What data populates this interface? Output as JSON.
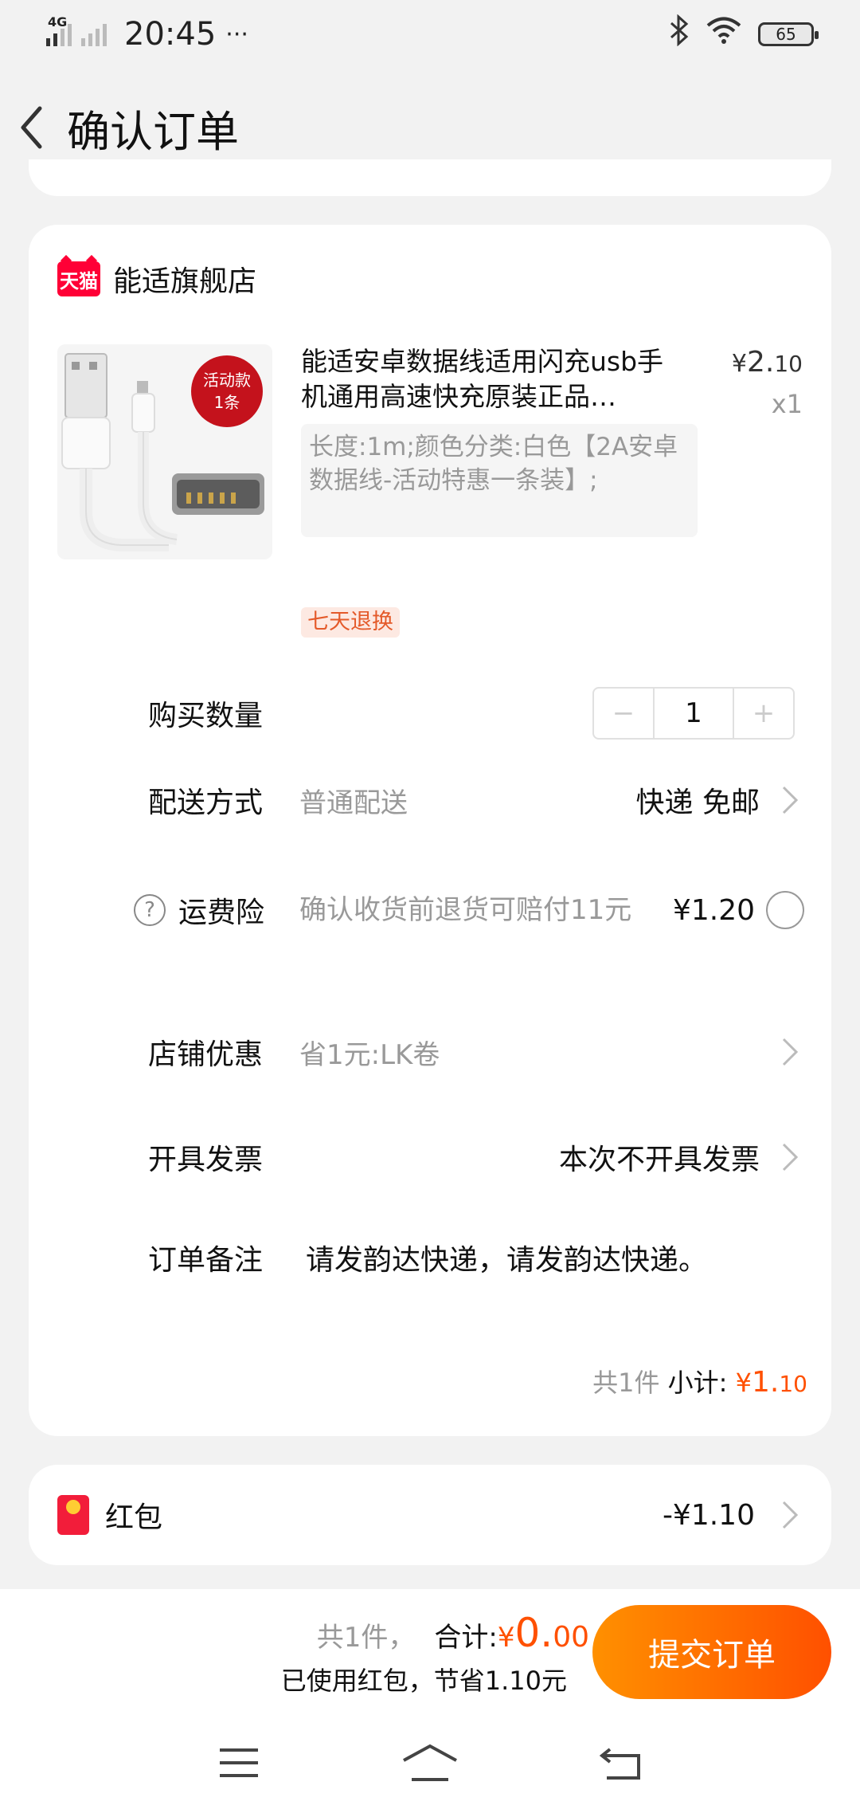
{
  "status_bar": {
    "network": "4G",
    "time": "20:45",
    "more": "···",
    "battery": "65"
  },
  "header": {
    "title": "确认订单"
  },
  "shop": {
    "logo_text": "天猫",
    "name": "能适旗舰店"
  },
  "product": {
    "badge_line1": "活动款",
    "badge_line2": "1条",
    "title": "能适安卓数据线适用闪充usb手机通用高速快充原装正品…",
    "price_symbol": "¥",
    "price_int": "2.",
    "price_dec": "10",
    "quantity": "x1",
    "sku": "长度:1m;颜色分类:白色【2A安卓数据线-活动特惠一条装】;",
    "return_tag": "七天退换"
  },
  "rows": {
    "quantity_label": "购买数量",
    "quantity_minus": "−",
    "quantity_value": "1",
    "quantity_plus": "+",
    "delivery_label": "配送方式",
    "delivery_sub": "普通配送",
    "delivery_value": "快递 免邮",
    "insurance_label": "运费险",
    "insurance_sub": "确认收货前退货可赔付11元",
    "insurance_price": "¥1.20",
    "coupon_label": "店铺优惠",
    "coupon_sub": "省1元:LK卷",
    "invoice_label": "开具发票",
    "invoice_value": "本次不开具发票",
    "note_label": "订单备注",
    "note_value": "请发韵达快递，请发韵达快递。"
  },
  "subtotal": {
    "count": "共1件",
    "label": "小计:",
    "symbol": "¥",
    "int": "1.",
    "dec": "10"
  },
  "red_packet": {
    "label": "红包",
    "value": "-¥1.10"
  },
  "bottom_bar": {
    "count": "共1件，",
    "total_label": "合计:",
    "symbol": "¥",
    "int": "0.",
    "dec": "00",
    "saving": "已使用红包，节省1.10元",
    "submit": "提交订单"
  },
  "colors": {
    "accent": "#ff5000",
    "tmall_red": "#ff0036",
    "muted": "#999999"
  }
}
